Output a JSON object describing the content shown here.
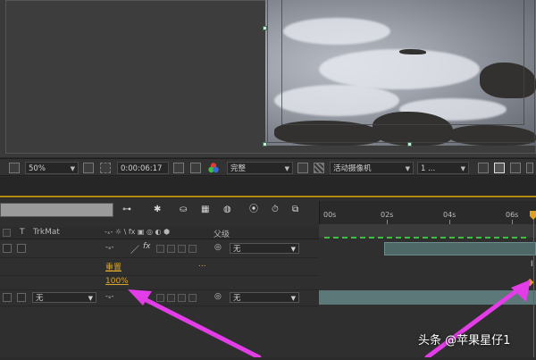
{
  "viewer_toolbar": {
    "zoom": "50%",
    "timecode": "0:00:06:17",
    "resolution": "完整",
    "camera": "活动摄像机",
    "views": "1 ..."
  },
  "timeline": {
    "ruler_labels": [
      "00s",
      "02s",
      "04s",
      "06s"
    ],
    "columns": {
      "t": "T",
      "trkmat": "TrkMat",
      "switches": "-ₓ- ☼ \\ fx ▣ ◎ ◐ ⬢",
      "parent": "父级"
    },
    "rows": [
      {
        "parent": "无"
      },
      {
        "property_name": "重置",
        "property_dots": "..."
      },
      {
        "property_value": "100%"
      },
      {
        "trkmat": "无",
        "parent": "无"
      }
    ]
  },
  "watermark": "头条 @苹果星仔1",
  "colors": {
    "accent_orange": "#b58a14",
    "playhead": "#c0392b",
    "annotation_arrow": "#e23de6",
    "layer_bar": "#5c7878"
  }
}
